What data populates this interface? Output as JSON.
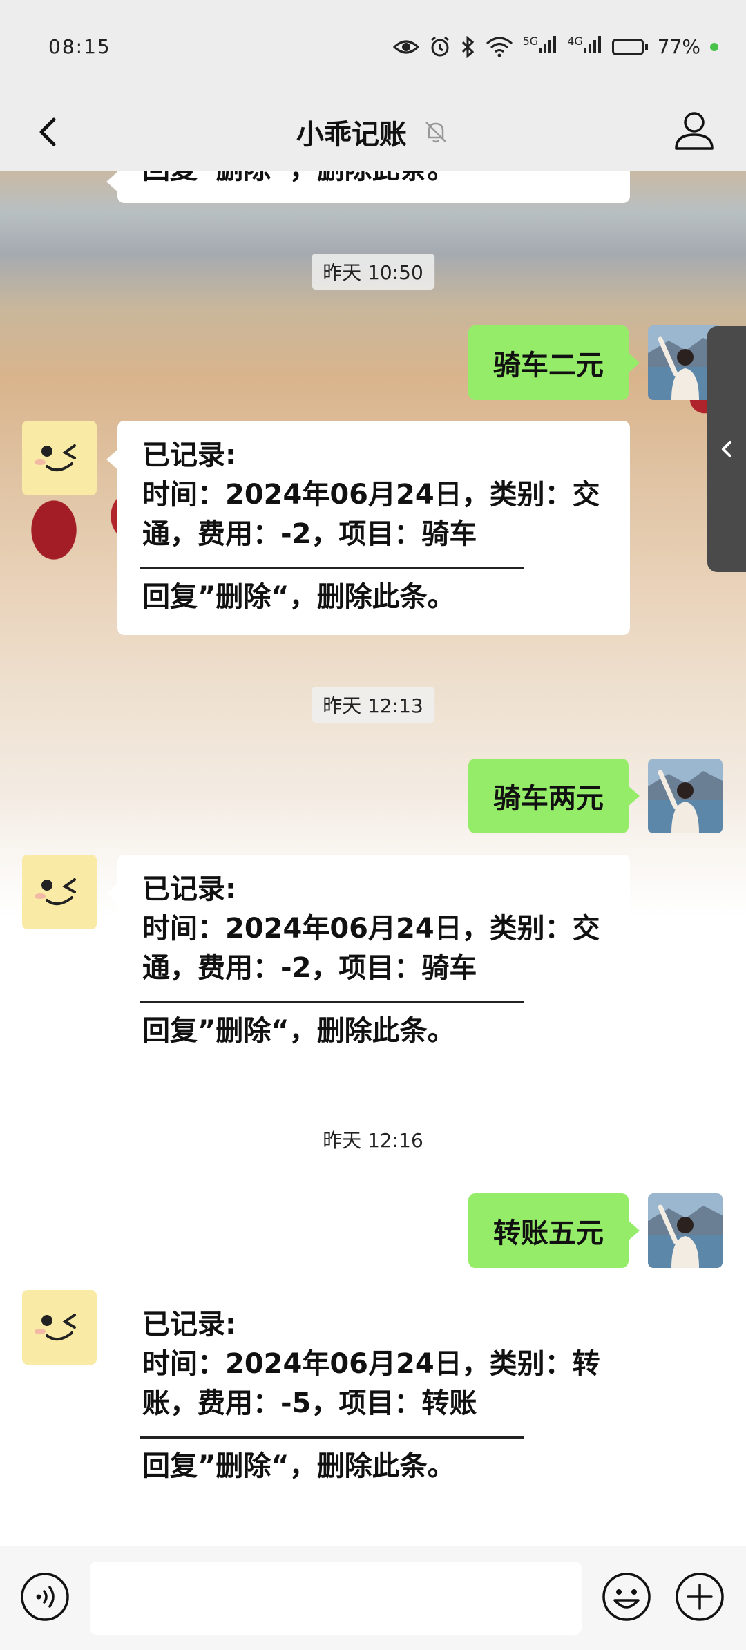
{
  "status_bar": {
    "time": "08:15",
    "network_5g": "5G",
    "network_4g": "4G",
    "battery_percent": "77%",
    "battery_level": 0.77
  },
  "header": {
    "title": "小乖记账"
  },
  "messages": {
    "top_partial": {
      "text": "回复”删除“，删除此条。"
    },
    "ts1": "昨天 10:50",
    "out1": "骑车二元",
    "in1": {
      "l1": "已记录:",
      "l2": "时间：2024年06月24日，类别：交",
      "l3": "通，费用：-2，项目：骑车",
      "l4": "回复”删除“，删除此条。"
    },
    "ts2": "昨天 12:13",
    "out2": "骑车两元",
    "in2": {
      "l1": "已记录:",
      "l2": "时间：2024年06月24日，类别：交",
      "l3": "通，费用：-2，项目：骑车",
      "l4": "回复”删除“，删除此条。"
    },
    "ts3": "昨天 12:16",
    "out3": "转账五元",
    "in3": {
      "l1": "已记录:",
      "l2": "时间：2024年06月24日，类别：转",
      "l3": "账，费用：-5，项目：转账",
      "l4": "回复”删除“，删除此条。"
    }
  },
  "input": {
    "placeholder": ""
  },
  "colors": {
    "outgoing_bubble": "#95ec69",
    "bar_background": "#ededed",
    "status_dot": "#49c24a"
  }
}
